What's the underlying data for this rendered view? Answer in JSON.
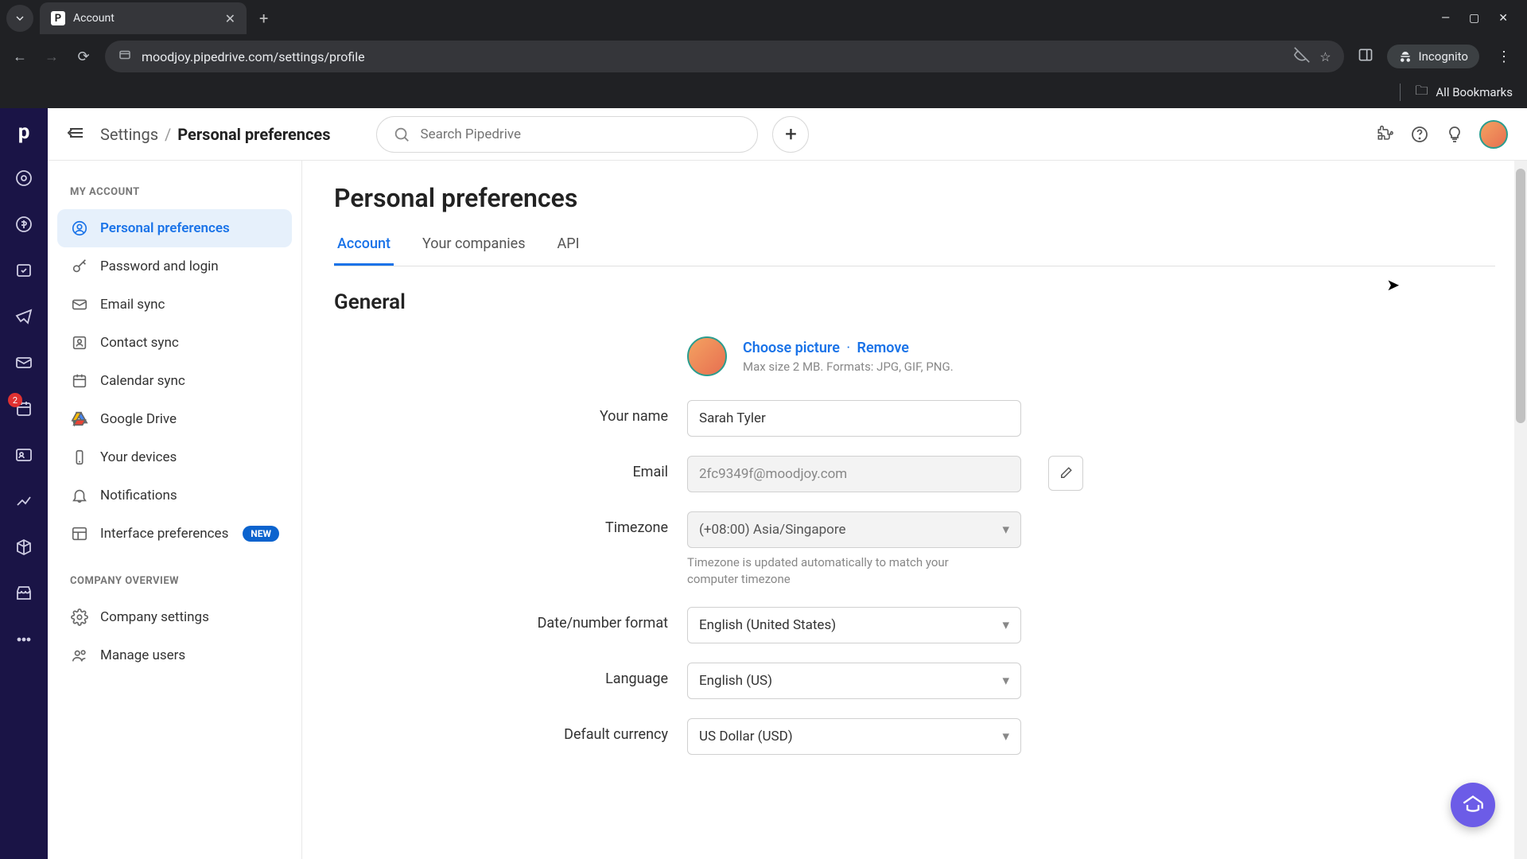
{
  "browser": {
    "tab_title": "Account",
    "url": "moodjoy.pipedrive.com/settings/profile",
    "incognito_label": "Incognito",
    "all_bookmarks": "All Bookmarks"
  },
  "topbar": {
    "breadcrumb_root": "Settings",
    "breadcrumb_current": "Personal preferences",
    "search_placeholder": "Search Pipedrive"
  },
  "rail": {
    "badge_count": "2"
  },
  "sidebar": {
    "section1": "MY ACCOUNT",
    "section2": "COMPANY OVERVIEW",
    "items": [
      {
        "label": "Personal preferences"
      },
      {
        "label": "Password and login"
      },
      {
        "label": "Email sync"
      },
      {
        "label": "Contact sync"
      },
      {
        "label": "Calendar sync"
      },
      {
        "label": "Google Drive"
      },
      {
        "label": "Your devices"
      },
      {
        "label": "Notifications"
      },
      {
        "label": "Interface preferences",
        "badge": "NEW"
      },
      {
        "label": "Company settings"
      },
      {
        "label": "Manage users"
      }
    ]
  },
  "main": {
    "title": "Personal preferences",
    "tabs": [
      "Account",
      "Your companies",
      "API"
    ],
    "section": "General",
    "avatar": {
      "choose": "Choose picture",
      "remove": "Remove",
      "hint": "Max size 2 MB. Formats: JPG, GIF, PNG."
    },
    "fields": {
      "name_label": "Your name",
      "name_value": "Sarah Tyler",
      "email_label": "Email",
      "email_value": "2fc9349f@moodjoy.com",
      "tz_label": "Timezone",
      "tz_value": "(+08:00) Asia/Singapore",
      "tz_hint": "Timezone is updated automatically to match your computer timezone",
      "datefmt_label": "Date/number format",
      "datefmt_value": "English (United States)",
      "lang_label": "Language",
      "lang_value": "English (US)",
      "currency_label": "Default currency",
      "currency_value": "US Dollar (USD)"
    }
  }
}
